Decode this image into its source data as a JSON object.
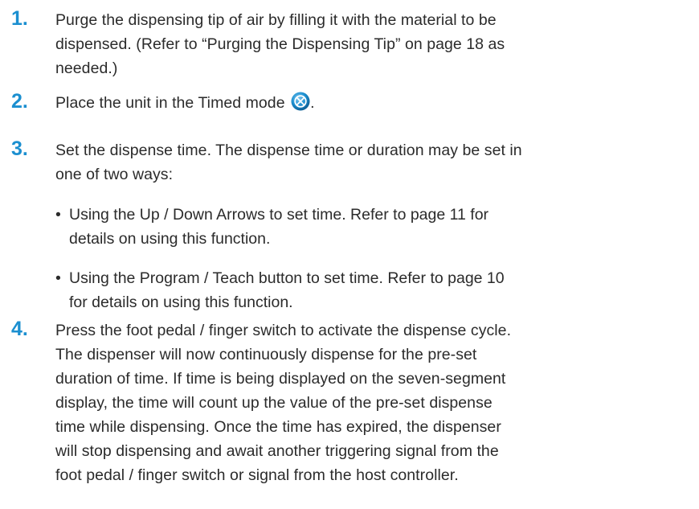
{
  "steps": [
    {
      "number": "1.",
      "lines": [
        "Purge the dispensing tip of air by filling it with the material to be",
        "dispensed. (Refer to “Purging the Dispensing Tip” on page 18 as",
        "needed.)"
      ]
    },
    {
      "number": "2.",
      "text_before_icon": "Place the unit in the Timed mode",
      "icon": "timed-mode-icon",
      "text_after_icon": "."
    },
    {
      "number": "3.",
      "lines": [
        "Set the dispense time. The dispense time or duration may be set in",
        "one of two ways:"
      ],
      "bullets": [
        {
          "lines": [
            "Using the Up / Down Arrows to set time. Refer to page 11 for",
            "details on using this function."
          ]
        },
        {
          "lines": [
            "Using the Program / Teach button to set time. Refer to page 10",
            "for details on using this function."
          ]
        }
      ]
    },
    {
      "number": "4.",
      "lines": [
        "Press the foot pedal / finger switch to activate the dispense cycle.",
        "The dispenser will now continuously dispense for the pre-set",
        "duration of time. If time is being displayed on the seven-segment",
        "display, the time will count up the value of the pre-set dispense",
        "time while dispensing. Once the time has expired, the dispenser",
        "will stop dispensing and await another triggering signal from the",
        "foot pedal / finger switch or signal from the host controller."
      ]
    }
  ],
  "bullet_char": "•",
  "colors": {
    "step_number": "#1b8fd0",
    "body_text": "#2b2b2b",
    "icon_fill": "#1b8fd0"
  }
}
